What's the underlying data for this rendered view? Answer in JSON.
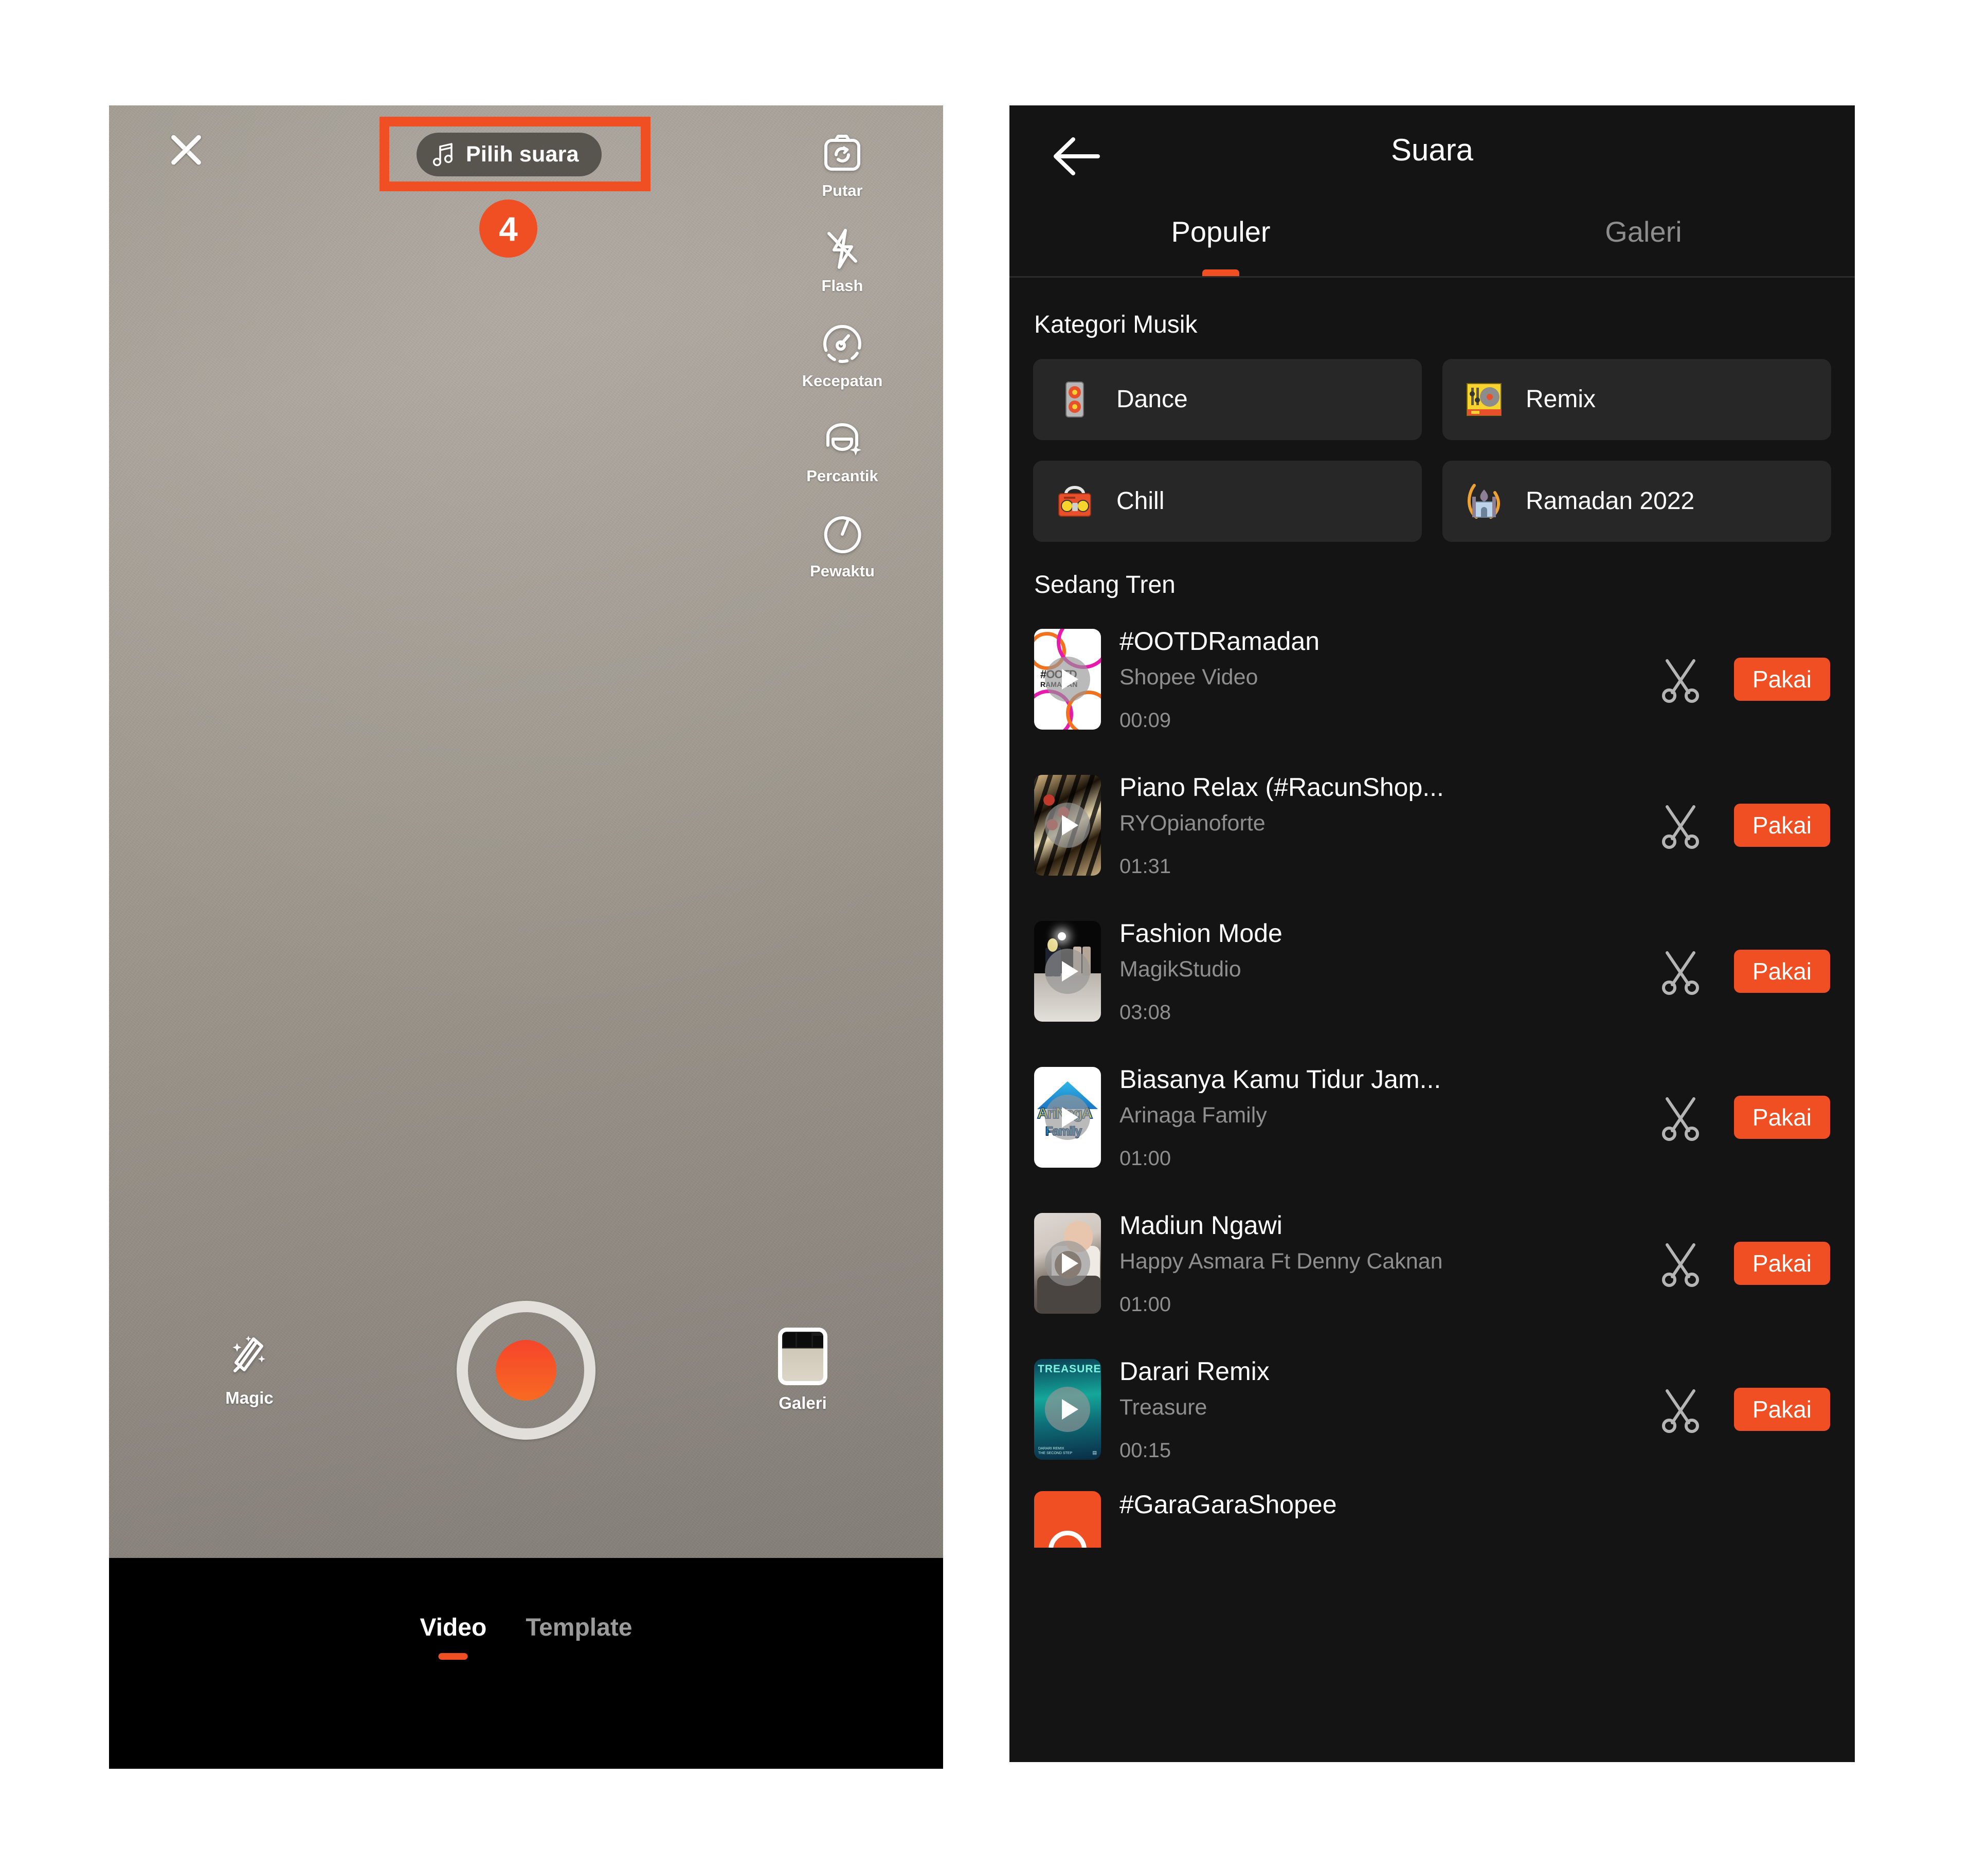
{
  "theme": {
    "accent": "#F04E23",
    "dark_bg": "#141414",
    "card_bg": "#272727",
    "muted_text": "#8f8f8f"
  },
  "camera_screen": {
    "close_icon": "close-icon",
    "sound_button": {
      "label": "Pilih suara",
      "icon": "music-note-icon",
      "highlighted": true
    },
    "step_badge": "4",
    "tools": [
      {
        "label": "Putar",
        "icon": "camera-flip-icon"
      },
      {
        "label": "Flash",
        "icon": "flash-off-icon"
      },
      {
        "label": "Kecepatan",
        "icon": "speed-gauge-icon"
      },
      {
        "label": "Percantik",
        "icon": "beautify-icon"
      },
      {
        "label": "Pewaktu",
        "icon": "timer-icon"
      }
    ],
    "bottom": {
      "magic_label": "Magic",
      "magic_icon": "magic-wand-icon",
      "shutter_icon": "record-button",
      "gallery_label": "Galeri",
      "gallery_icon": "gallery-thumbnail-icon"
    },
    "modes": [
      {
        "label": "Video",
        "active": true
      },
      {
        "label": "Template",
        "active": false
      }
    ]
  },
  "sound_screen": {
    "header": {
      "back_icon": "back-arrow-icon",
      "title": "Suara"
    },
    "tabs": [
      {
        "label": "Populer",
        "active": true
      },
      {
        "label": "Galeri",
        "active": false
      }
    ],
    "category_section_title": "Kategori Musik",
    "categories": [
      {
        "label": "Dance",
        "icon": "speaker-icon"
      },
      {
        "label": "Remix",
        "icon": "turntable-icon"
      },
      {
        "label": "Chill",
        "icon": "boombox-icon"
      },
      {
        "label": "Ramadan 2022",
        "icon": "mosque-icon"
      }
    ],
    "trending_section_title": "Sedang Tren",
    "use_button_label": "Pakai",
    "trim_icon": "scissors-icon",
    "songs": [
      {
        "title": "#OOTDRamadan",
        "artist": "Shopee Video",
        "duration": "00:09",
        "thumb": "ootd-ramadan-cover"
      },
      {
        "title": "Piano Relax (#RacunShop...",
        "artist": "RYOpianoforte",
        "duration": "01:31",
        "thumb": "piano-cover"
      },
      {
        "title": "Fashion Mode",
        "artist": "MagikStudio",
        "duration": "03:08",
        "thumb": "fashion-runway-cover"
      },
      {
        "title": "Biasanya Kamu Tidur Jam...",
        "artist": "Arinaga Family",
        "duration": "01:00",
        "thumb": "arinaga-family-cover"
      },
      {
        "title": "Madiun Ngawi",
        "artist": "Happy Asmara Ft Denny Caknan",
        "duration": "01:00",
        "thumb": "madiun-ngawi-cover"
      },
      {
        "title": "Darari Remix",
        "artist": "Treasure",
        "duration": "00:15",
        "thumb": "treasure-cover"
      },
      {
        "title": "#GaraGaraShopee",
        "artist": "",
        "duration": "",
        "thumb": "gara-gara-shopee-cover"
      }
    ]
  }
}
